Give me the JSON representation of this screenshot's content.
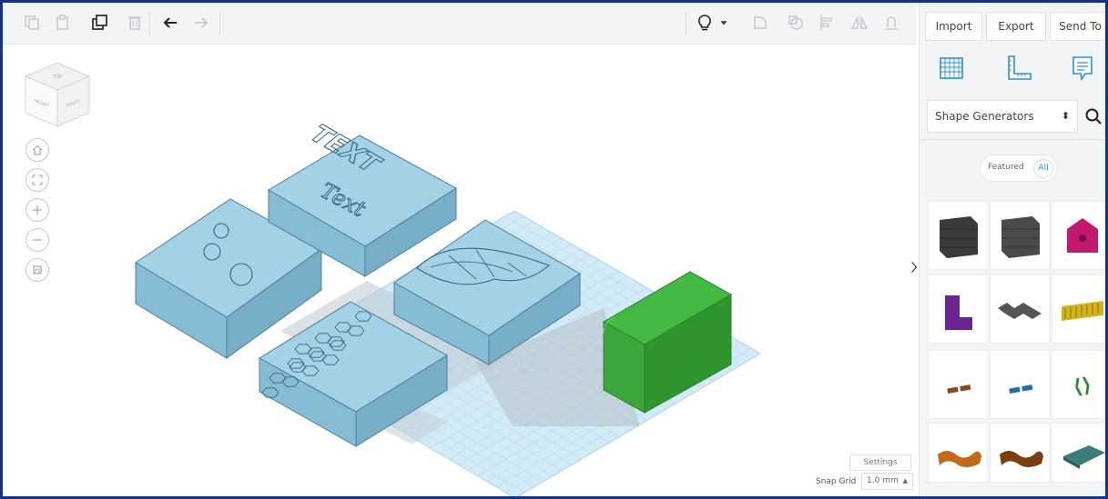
{
  "toolbar": {
    "icons": [
      "copy-icon",
      "paste-icon",
      "duplicate-icon",
      "delete-icon",
      "undo-icon",
      "redo-icon",
      "lightbulb-icon",
      "dropdown-caret-icon",
      "group-icon",
      "ungroup-icon",
      "align-icon",
      "mirror-icon",
      "cruise-icon"
    ]
  },
  "viewcube": {
    "top": "TOP",
    "front": "FRONT",
    "right": "RIGHT"
  },
  "canvas": {
    "settings_label": "Settings",
    "snap_grid_label": "Snap Grid",
    "snap_grid_value": "1.0 mm",
    "snap_grid_caret": "▲"
  },
  "scene": {
    "tile_color": "#88c4dd",
    "box_color": "#3bab3b",
    "grid_color": "#bfe0f2",
    "text_stamp_line1": "TEXT",
    "text_stamp_line2": "Text"
  },
  "panel": {
    "import_label": "Import",
    "export_label": "Export",
    "sendto_label": "Send To",
    "library_label": "Shape Generators",
    "library_arrows": "⌃⌄",
    "filter_featured": "Featured",
    "filter_all": "All",
    "shapes": [
      {
        "name": "brick-wall",
        "color": "#3a3a3a"
      },
      {
        "name": "stone-wall",
        "color": "#4a4a4a"
      },
      {
        "name": "birdhouse",
        "color": "#c0196e"
      },
      {
        "name": "chair",
        "color": "#6a2591"
      },
      {
        "name": "stairs",
        "color": "#555555"
      },
      {
        "name": "comb",
        "color": "#d4b21a"
      },
      {
        "name": "text-3d-brown",
        "color": "#8a4a1a"
      },
      {
        "name": "text-3d-blue",
        "color": "#1f6fb0"
      },
      {
        "name": "text-3d-green",
        "color": "#2e8b3a"
      },
      {
        "name": "script-orange",
        "color": "#c06a1a"
      },
      {
        "name": "script-brown",
        "color": "#7a3e10"
      },
      {
        "name": "plate-teal",
        "color": "#3c7d7a"
      }
    ]
  },
  "accent_color": "#2a8fd8"
}
